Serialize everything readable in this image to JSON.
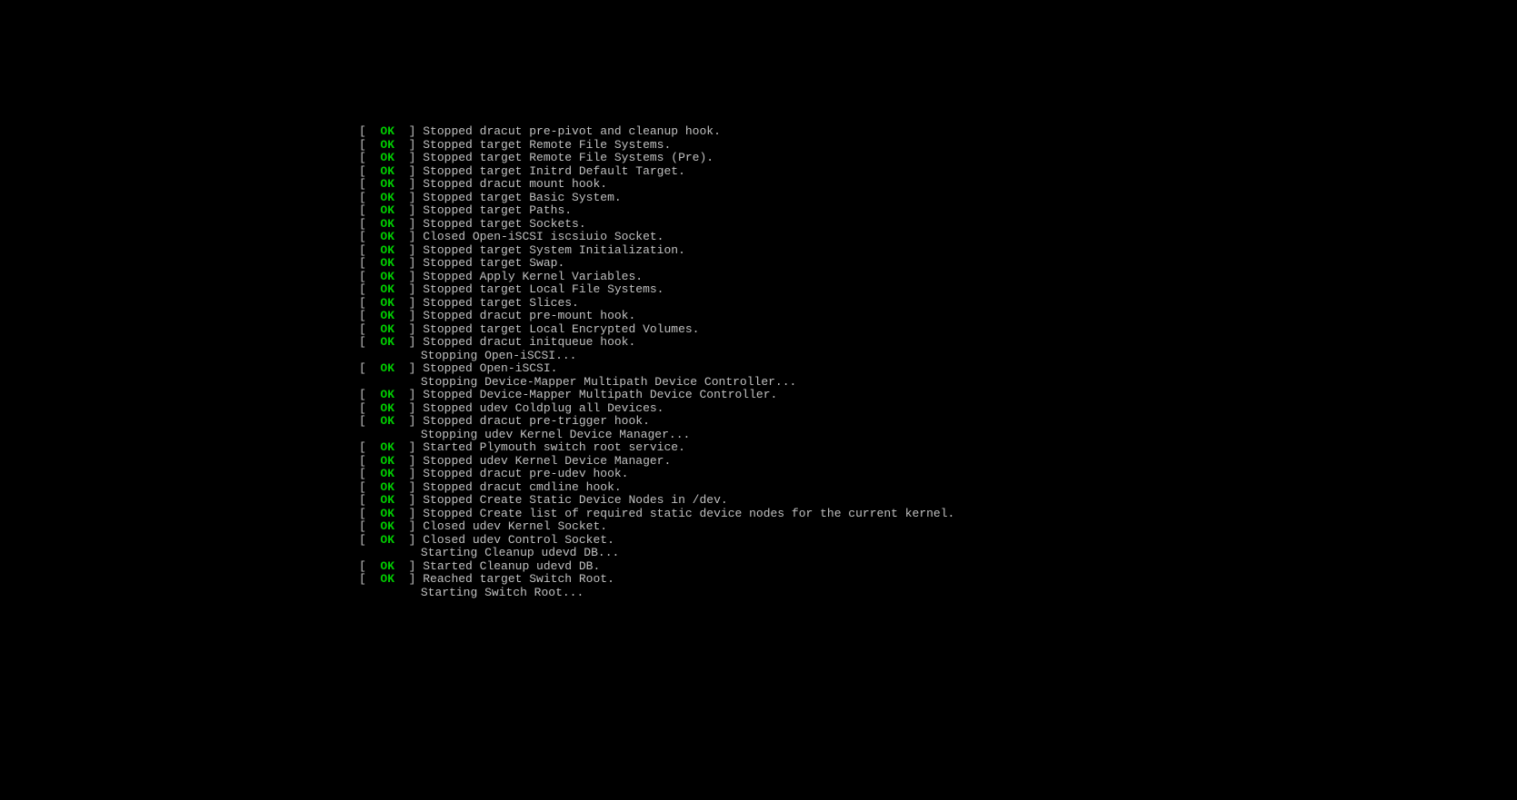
{
  "status_ok": "OK",
  "lines": [
    {
      "status": "ok",
      "msg": "Stopped dracut pre-pivot and cleanup hook."
    },
    {
      "status": "ok",
      "msg": "Stopped target Remote File Systems."
    },
    {
      "status": "ok",
      "msg": "Stopped target Remote File Systems (Pre)."
    },
    {
      "status": "ok",
      "msg": "Stopped target Initrd Default Target."
    },
    {
      "status": "ok",
      "msg": "Stopped dracut mount hook."
    },
    {
      "status": "ok",
      "msg": "Stopped target Basic System."
    },
    {
      "status": "ok",
      "msg": "Stopped target Paths."
    },
    {
      "status": "ok",
      "msg": "Stopped target Sockets."
    },
    {
      "status": "ok",
      "msg": "Closed Open-iSCSI iscsiuio Socket."
    },
    {
      "status": "ok",
      "msg": "Stopped target System Initialization."
    },
    {
      "status": "ok",
      "msg": "Stopped target Swap."
    },
    {
      "status": "ok",
      "msg": "Stopped Apply Kernel Variables."
    },
    {
      "status": "ok",
      "msg": "Stopped target Local File Systems."
    },
    {
      "status": "ok",
      "msg": "Stopped target Slices."
    },
    {
      "status": "ok",
      "msg": "Stopped dracut pre-mount hook."
    },
    {
      "status": "ok",
      "msg": "Stopped target Local Encrypted Volumes."
    },
    {
      "status": "ok",
      "msg": "Stopped dracut initqueue hook."
    },
    {
      "status": "plain",
      "msg": "Stopping Open-iSCSI..."
    },
    {
      "status": "ok",
      "msg": "Stopped Open-iSCSI."
    },
    {
      "status": "plain",
      "msg": "Stopping Device-Mapper Multipath Device Controller..."
    },
    {
      "status": "ok",
      "msg": "Stopped Device-Mapper Multipath Device Controller."
    },
    {
      "status": "ok",
      "msg": "Stopped udev Coldplug all Devices."
    },
    {
      "status": "ok",
      "msg": "Stopped dracut pre-trigger hook."
    },
    {
      "status": "plain",
      "msg": "Stopping udev Kernel Device Manager..."
    },
    {
      "status": "ok",
      "msg": "Started Plymouth switch root service."
    },
    {
      "status": "ok",
      "msg": "Stopped udev Kernel Device Manager."
    },
    {
      "status": "ok",
      "msg": "Stopped dracut pre-udev hook."
    },
    {
      "status": "ok",
      "msg": "Stopped dracut cmdline hook."
    },
    {
      "status": "ok",
      "msg": "Stopped Create Static Device Nodes in /dev."
    },
    {
      "status": "ok",
      "msg": "Stopped Create list of required static device nodes for the current kernel."
    },
    {
      "status": "ok",
      "msg": "Closed udev Kernel Socket."
    },
    {
      "status": "ok",
      "msg": "Closed udev Control Socket."
    },
    {
      "status": "plain",
      "msg": "Starting Cleanup udevd DB..."
    },
    {
      "status": "ok",
      "msg": "Started Cleanup udevd DB."
    },
    {
      "status": "ok",
      "msg": "Reached target Switch Root."
    },
    {
      "status": "plain",
      "msg": "Starting Switch Root..."
    }
  ]
}
